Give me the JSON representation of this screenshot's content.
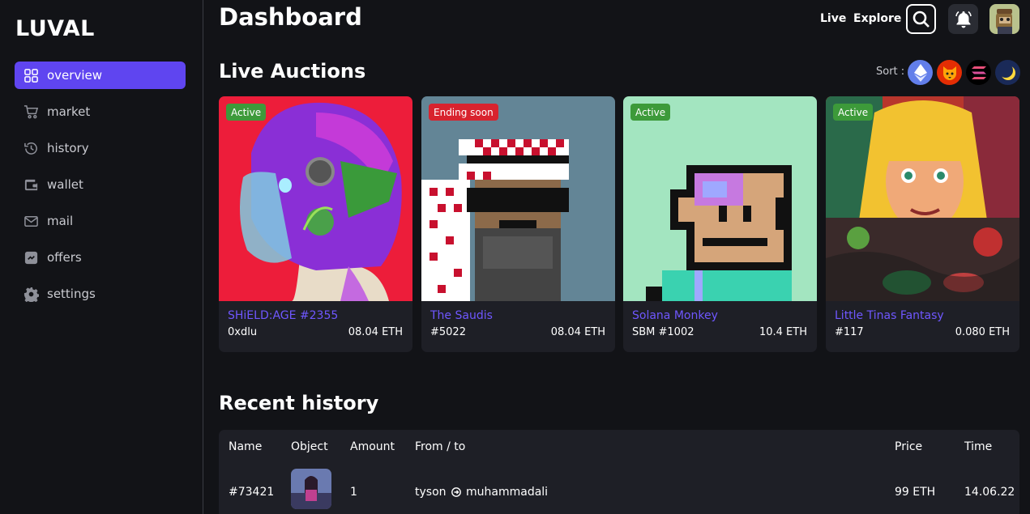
{
  "app": {
    "logo": "LUVAL"
  },
  "sidebar": {
    "items": [
      {
        "label": "overview",
        "icon": "grid-icon",
        "active": true
      },
      {
        "label": "market",
        "icon": "cart-icon"
      },
      {
        "label": "history",
        "icon": "history-icon"
      },
      {
        "label": "wallet",
        "icon": "wallet-icon"
      },
      {
        "label": "mail",
        "icon": "mail-icon"
      },
      {
        "label": "offers",
        "icon": "offers-icon"
      },
      {
        "label": "settings",
        "icon": "gear-icon"
      }
    ]
  },
  "header": {
    "title": "Dashboard",
    "links": [
      "Live",
      "Explore"
    ],
    "icons": [
      "search-icon",
      "bell-icon",
      "avatar"
    ]
  },
  "auctions": {
    "title": "Live Auctions",
    "sort_label": "Sort :",
    "sort_coins": [
      "ethereum-icon",
      "shiba-icon",
      "solana-icon",
      "luna-icon"
    ],
    "cards": [
      {
        "status": "Active",
        "name": "SHiELD:AGE #2355",
        "id": "0xdlu",
        "price": "08.04 ETH"
      },
      {
        "status": "Ending soon",
        "name": "The Saudis",
        "id": "#5022",
        "price": "08.04 ETH"
      },
      {
        "status": "Active",
        "name": "Solana Monkey",
        "id": "SBM #1002",
        "price": "10.4 ETH"
      },
      {
        "status": "Active",
        "name": "Little Tinas Fantasy",
        "id": "#117",
        "price": "0.080 ETH"
      }
    ]
  },
  "history": {
    "title": "Recent history",
    "columns": [
      "Name",
      "Object",
      "Amount",
      "From / to",
      "Price",
      "Time"
    ],
    "rows": [
      {
        "name": "#73421",
        "amount": "1",
        "from": "tyson",
        "to": "muhammadali",
        "price": "99 ETH",
        "time": "14.06.22"
      }
    ]
  },
  "colors": {
    "accent": "#5f45f0",
    "link": "#6f57ff",
    "active_badge": "#3d9a3a",
    "ending_badge": "#d8232e",
    "card_bg": "#1e1f26",
    "page_bg": "#121317"
  }
}
